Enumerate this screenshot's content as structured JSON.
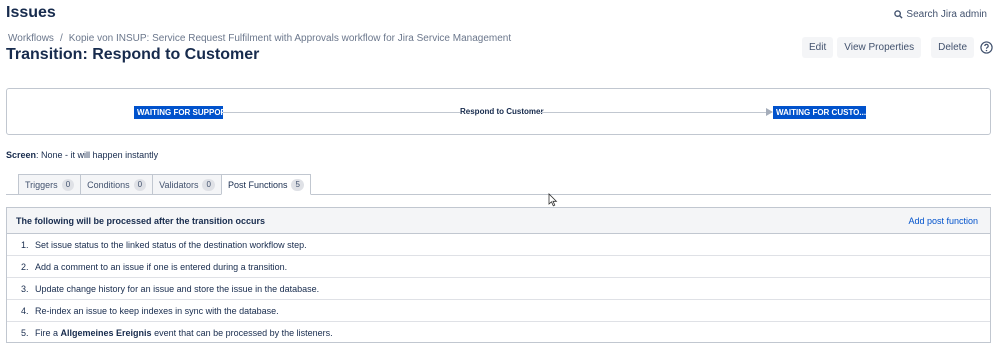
{
  "header": {
    "title": "Issues",
    "search_label": "Search Jira admin"
  },
  "breadcrumb": {
    "root": "Workflows",
    "separator": "/",
    "workflow": "Kopie von INSUP: Service Request Fulfilment with Approvals workflow for Jira Service Management"
  },
  "page_title": "Transition: Respond to Customer",
  "actions": {
    "edit": "Edit",
    "view_properties": "View Properties",
    "delete": "Delete"
  },
  "diagram": {
    "from_status": "WAITING FOR SUPPORT",
    "transition": "Respond to Customer",
    "to_status": "WAITING FOR CUSTO..."
  },
  "screen": {
    "label": "Screen",
    "value": ": None - it will happen instantly"
  },
  "tabs": [
    {
      "label": "Triggers",
      "count": "0"
    },
    {
      "label": "Conditions",
      "count": "0"
    },
    {
      "label": "Validators",
      "count": "0"
    },
    {
      "label": "Post Functions",
      "count": "5"
    }
  ],
  "panel": {
    "heading": "The following will be processed after the transition occurs",
    "add_link": "Add post function",
    "items": [
      {
        "num": "1.",
        "text": "Set issue status to the linked status of the destination workflow step."
      },
      {
        "num": "2.",
        "text": "Add a comment to an issue if one is entered during a transition."
      },
      {
        "num": "3.",
        "text": "Update change history for an issue and store the issue in the database."
      },
      {
        "num": "4.",
        "text": "Re-index an issue to keep indexes in sync with the database."
      },
      {
        "num": "5.",
        "text_before": "Fire a ",
        "bold": "Allgemeines Ereignis",
        "text_after": " event that can be processed by the listeners."
      }
    ]
  },
  "colors": {
    "accent": "#0052cc",
    "text": "#172b4d",
    "border": "#c1c7d0",
    "surface": "#f4f5f7"
  },
  "icons": [
    "search-icon",
    "help-icon",
    "arrow-right-icon",
    "mouse-cursor-icon"
  ]
}
